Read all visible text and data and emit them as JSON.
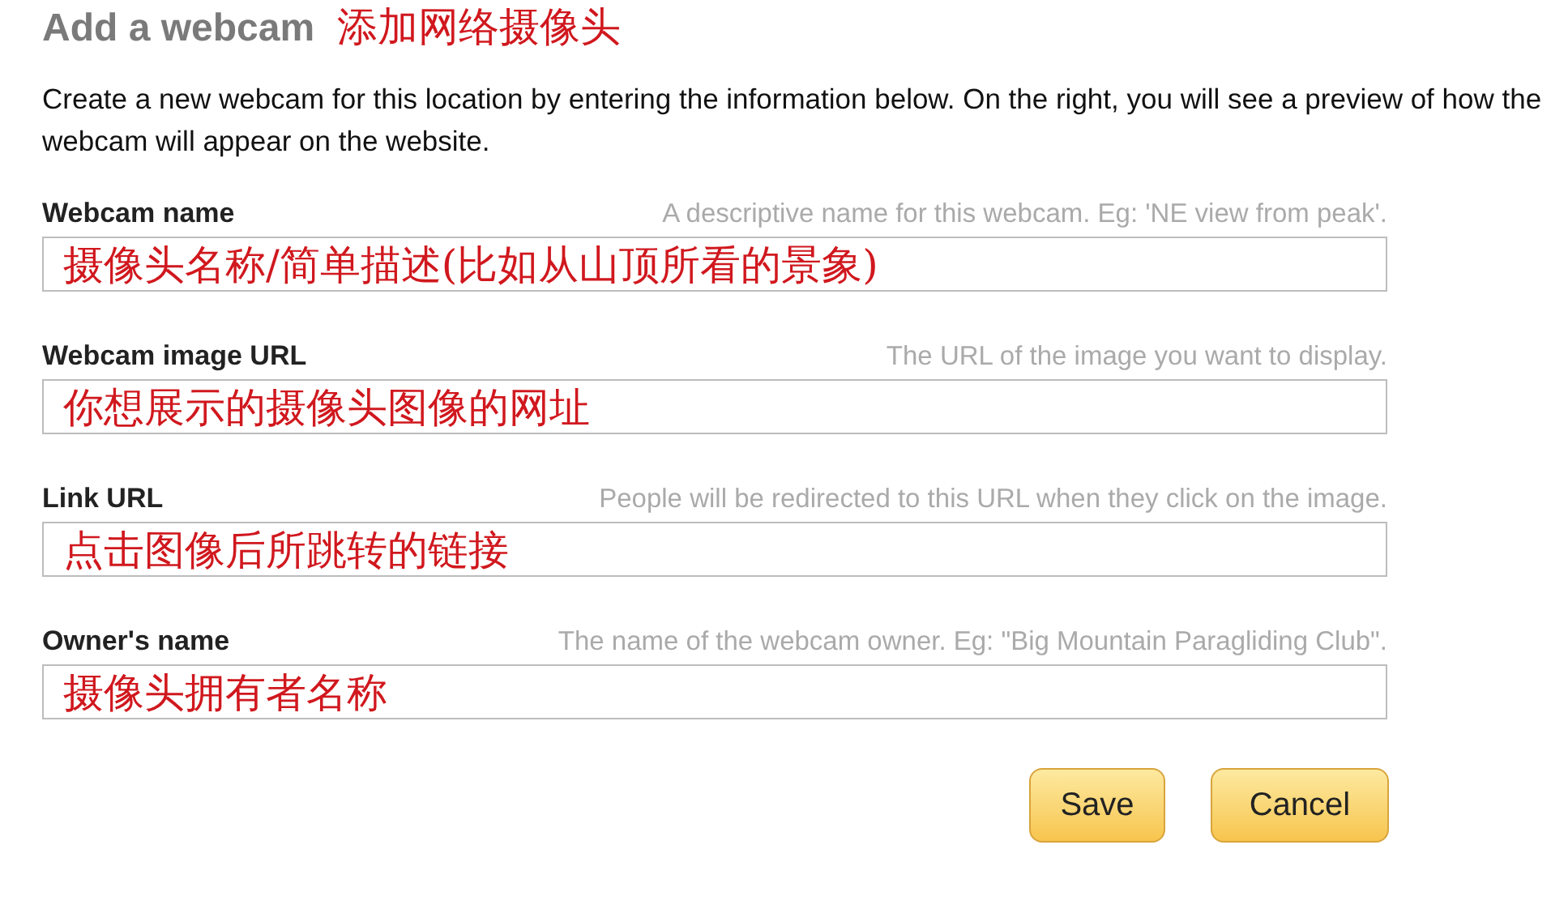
{
  "title": "Add a webcam",
  "title_note": "添加网络摄像头",
  "description": "Create a new webcam for this location by entering the information below. On the right, you will see a preview of how the webcam will appear on the website.",
  "fields": [
    {
      "label": "Webcam name",
      "hint": "A descriptive name for this webcam. Eg: 'NE view from peak'.",
      "value": "摄像头名称/简单描述(比如从山顶所看的景象)"
    },
    {
      "label": "Webcam image URL",
      "hint": "The URL of the image you want to display.",
      "value": "你想展示的摄像头图像的网址"
    },
    {
      "label": "Link URL",
      "hint": "People will be redirected to this URL when they click on the image.",
      "value": "点击图像后所跳转的链接"
    },
    {
      "label": "Owner's name",
      "hint": "The name of the webcam owner. Eg: \"Big Mountain Paragliding Club\".",
      "value": "摄像头拥有者名称"
    }
  ],
  "buttons": [
    "Save",
    "Cancel"
  ]
}
